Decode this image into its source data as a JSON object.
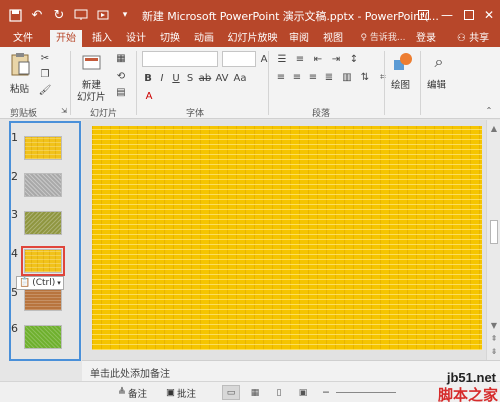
{
  "window": {
    "title": "新建 Microsoft PowerPoint 演示文稿.pptx - PowerPoint(..."
  },
  "tabs": [
    {
      "label": "文件"
    },
    {
      "label": "开始"
    },
    {
      "label": "插入"
    },
    {
      "label": "设计"
    },
    {
      "label": "切换"
    },
    {
      "label": "动画"
    },
    {
      "label": "幻灯片放映"
    },
    {
      "label": "审阅"
    },
    {
      "label": "视图"
    }
  ],
  "tell_me": "♀ 告诉我...",
  "login": "登录",
  "share": "共享",
  "ribbon": {
    "paste": "粘贴",
    "new_slide_line1": "新建",
    "new_slide_line2": "幻灯片",
    "drawing": "绘图",
    "editing": "编辑",
    "groups": {
      "clipboard": "剪贴板",
      "slides": "幻灯片",
      "font": "字体",
      "paragraph": "段落"
    }
  },
  "slides": [
    {
      "number": "1",
      "pattern": "yellow"
    },
    {
      "number": "2",
      "pattern": "gray"
    },
    {
      "number": "3",
      "pattern": "olive"
    },
    {
      "number": "4",
      "pattern": "yellow",
      "selected": true
    },
    {
      "number": "5",
      "pattern": "brown"
    },
    {
      "number": "6",
      "pattern": "green"
    }
  ],
  "paste_options": "(Ctrl)",
  "notes_placeholder": "单击此处添加备注",
  "status": {
    "notes_btn": "备注",
    "comments_btn": "批注"
  },
  "watermark": {
    "url": "jb51.net",
    "name": "脚本之家"
  },
  "colors": {
    "accent": "#b7472a",
    "selection": "#4a90d9",
    "slide_fill": "#f5c400"
  }
}
